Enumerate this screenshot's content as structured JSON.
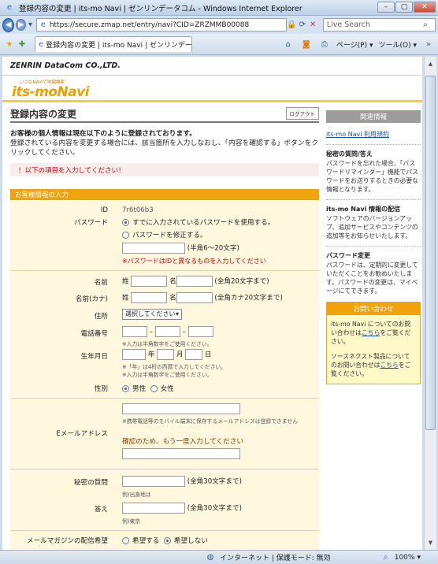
{
  "window": {
    "title": "登録内容の変更 | its-mo Navi | ゼンリンデータコム - Windows Internet Explorer",
    "min": "–",
    "max": "▢",
    "close": "✕"
  },
  "address": {
    "url": "https://secure.zmap.net/entry/navi?CID=ZRZMMB00088",
    "search_placeholder": "Live Search"
  },
  "tab": {
    "label": "登録内容の変更 | its-mo Navi | ゼンリンデー..."
  },
  "toolbar": {
    "page": "ページ(P) ▾",
    "tools": "ツール(O) ▾"
  },
  "status": {
    "zone": "インターネット | 保護モード: 無効",
    "zoom": "100%"
  },
  "brand": "ZENRIN DataCom CO.,LTD.",
  "logo": {
    "tagline": "いつもNAVIで地図検索",
    "text": "its-moNavi"
  },
  "page": {
    "title": "登録内容の変更",
    "logout": "ログアウト",
    "intro_bold": "お客様の個人情報は現在以下のように登録されております。",
    "intro": "登録されている内容を変更する場合には、該当箇所を入力しなおし、「内容を確認する」ボタンをクリックしてください。",
    "error": "！以下の項目を入力してください！",
    "section": "お客様情報の入力"
  },
  "form": {
    "id_label": "ID",
    "id_value": "7r6t06b3",
    "password_label": "パスワード",
    "password_keep": "すでに入力されているパスワードを使用する。",
    "password_change": "パスワードを修正する。",
    "password_hint": "(半角6〜20文字)",
    "password_warn": "※パスワードはIDと異なるものを入力してください",
    "name_label": "名前",
    "kana_label": "名前(カナ)",
    "sei": "姓",
    "mei": "名",
    "name_hint": "(全角20文字まで)",
    "kana_hint": "(全角カナ20文字まで)",
    "address_label": "住所",
    "address_select": "選択してください",
    "phone_label": "電話番号",
    "phone_dash": "–",
    "phone_note": "※入力は半角数字をご使用ください。",
    "birth_label": "生年月日",
    "year": "年",
    "month": "月",
    "day": "日",
    "birth_note1": "※「年」は4桁の西暦で入力してください。",
    "birth_note2": "※入力は半角数字をご使用ください。",
    "gender_label": "性別",
    "male": "男性",
    "female": "女性",
    "email_label": "Eメールアドレス",
    "email_note": "※携帯電話等のモバイル端末に保存するメールアドレスは登録できません",
    "email_confirm": "確認のため、もう一度入力してください",
    "secret_q_label": "秘密の質問",
    "secret_q_hint": "(全角30文字まで)",
    "secret_q_example": "例)出身地は",
    "answer_label": "答え",
    "answer_hint": "(全角30文字まで)",
    "answer_example": "例)東京",
    "magazine_label": "メールマガジンの配信希望",
    "magazine_yes": "希望する",
    "magazine_no": "希望しない"
  },
  "side": {
    "header": "関連情報",
    "terms_link": "its-mo Navi 利用規約",
    "q_title": "秘密の質問/答え",
    "q_text": "パスワードを忘れた場合、「パスワードリマインダー」機能でパスワードをお送りするときの必要な情報となります。",
    "mail_title": "its-mo Navi 情報の配信",
    "mail_text": "ソフトウェアのバージョンアップ、追加サービスやコンテンツの追加等をお知らせいたします。",
    "pw_title": "パスワード変更",
    "pw_text": "パスワードは、定期的に変更していただくことをお勧めいたします。パスワードの変更は、マイページにてできます。",
    "contact_header": "お問い合わせ",
    "contact_1a": "its-mo Navi についてのお問い合わせは",
    "contact_1link": "こちら",
    "contact_1b": "をご覧ください。",
    "contact_2a": "ソースネクスト製品についてのお問い合わせは",
    "contact_2link": "こちら",
    "contact_2b": "をご覧ください。"
  }
}
